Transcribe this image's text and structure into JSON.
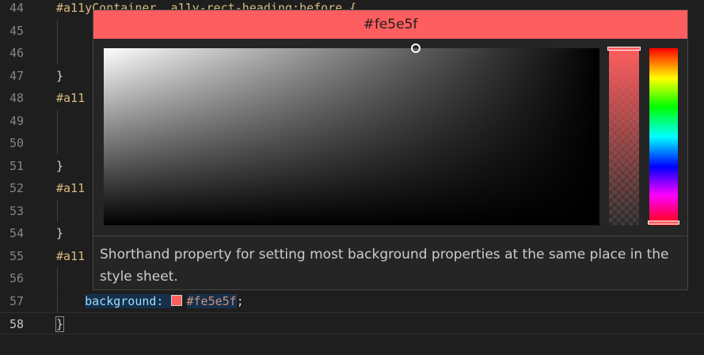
{
  "editor": {
    "lines": [
      {
        "num": "44",
        "parts": [
          {
            "t": "#a11yContainer .a11y-rect-heading:before {",
            "c": "sel"
          }
        ]
      },
      {
        "num": "45",
        "parts": []
      },
      {
        "num": "46",
        "parts": []
      },
      {
        "num": "47",
        "parts": [
          {
            "t": "}",
            "c": "brace"
          }
        ]
      },
      {
        "num": "48",
        "parts": [
          {
            "t": "#a11",
            "c": "sel"
          }
        ]
      },
      {
        "num": "49",
        "parts": []
      },
      {
        "num": "50",
        "parts": []
      },
      {
        "num": "51",
        "parts": [
          {
            "t": "}",
            "c": "brace"
          }
        ]
      },
      {
        "num": "52",
        "parts": [
          {
            "t": "#a11",
            "c": "sel"
          }
        ]
      },
      {
        "num": "53",
        "parts": []
      },
      {
        "num": "54",
        "parts": [
          {
            "t": "}",
            "c": "brace"
          }
        ]
      },
      {
        "num": "55",
        "parts": [
          {
            "t": "#a11",
            "c": "sel"
          }
        ]
      },
      {
        "num": "56",
        "parts": []
      },
      {
        "num": "57",
        "parts": [
          {
            "t": "    ",
            "c": "plain"
          },
          {
            "t": "background: ",
            "c": "prop"
          },
          {
            "t": "#fe5e5f",
            "c": "val",
            "swatch": true
          },
          {
            "t": ";",
            "c": "plain"
          }
        ]
      },
      {
        "num": "58",
        "parts": [
          {
            "t": "}",
            "c": "brace",
            "box": true
          }
        ],
        "current": true
      }
    ]
  },
  "color_picker": {
    "header_value": "#fe5e5f",
    "color": "#fe5e5f",
    "saturation_handle_x": 0.63,
    "hue_handle_position": 0.98,
    "opacity_handle_position": 0.0
  },
  "hover": {
    "description": "Shorthand property for setting most background properties at the same place in the style sheet."
  },
  "colors": {
    "selector": "#d7ba7d",
    "property": "#9cdcfe",
    "value": "#ce9178",
    "background": "#1e1e1e"
  }
}
